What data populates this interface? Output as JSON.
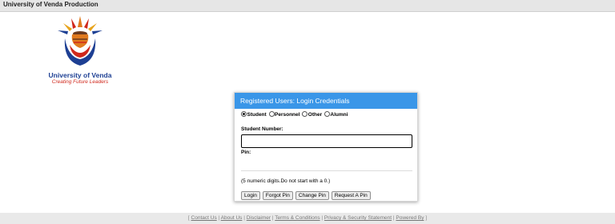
{
  "header": {
    "title": "University of Venda Production"
  },
  "logo": {
    "name": "University of Venda",
    "tagline": "Creating Future Leaders"
  },
  "login": {
    "title": "Registered Users: Login Credentials",
    "user_types": [
      "Student",
      "Personnel",
      "Other",
      "Alumni"
    ],
    "selected_type": "Student",
    "student_number_label": "Student Number:",
    "student_number_value": "",
    "pin_label": "Pin:",
    "hint": "(5 numeric digits.Do not start with a 0.)",
    "buttons": [
      "Login",
      "Forgot Pin",
      "Change Pin",
      "Request A Pin"
    ]
  },
  "footer": {
    "links": [
      "Contact Us",
      "About Us",
      "Disclaimer",
      "Terms & Conditions",
      "Privacy & Security Statement",
      "Powered By"
    ]
  },
  "colors": {
    "header_blue": "#3a96e8",
    "brand_blue": "#1d3f93",
    "tagline_red": "#d0281c"
  }
}
